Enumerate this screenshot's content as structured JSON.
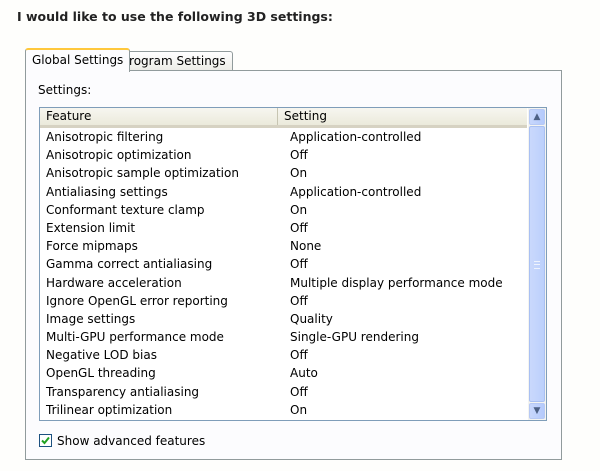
{
  "heading": "I would like to use the following 3D settings:",
  "tabs": [
    {
      "label": "Global Settings",
      "active": true
    },
    {
      "label": "Program Settings",
      "active": false
    }
  ],
  "settings_label": "Settings:",
  "columns": {
    "feature": "Feature",
    "setting": "Setting"
  },
  "rows": [
    {
      "feature": "Anisotropic filtering",
      "setting": "Application-controlled"
    },
    {
      "feature": "Anisotropic optimization",
      "setting": "Off"
    },
    {
      "feature": "Anisotropic sample optimization",
      "setting": "On"
    },
    {
      "feature": "Antialiasing settings",
      "setting": "Application-controlled"
    },
    {
      "feature": "Conformant texture clamp",
      "setting": "On"
    },
    {
      "feature": "Extension limit",
      "setting": "Off"
    },
    {
      "feature": "Force mipmaps",
      "setting": "None"
    },
    {
      "feature": "Gamma correct antialiasing",
      "setting": "Off"
    },
    {
      "feature": "Hardware acceleration",
      "setting": "Multiple display performance mode"
    },
    {
      "feature": "Ignore OpenGL error reporting",
      "setting": "Off"
    },
    {
      "feature": "Image settings",
      "setting": "Quality"
    },
    {
      "feature": "Multi-GPU performance mode",
      "setting": "Single-GPU rendering"
    },
    {
      "feature": "Negative LOD bias",
      "setting": "Off"
    },
    {
      "feature": "OpenGL threading",
      "setting": "Auto"
    },
    {
      "feature": "Transparency antialiasing",
      "setting": "Off"
    },
    {
      "feature": "Trilinear optimization",
      "setting": "On"
    }
  ],
  "scrollbar": {
    "up_icon": "arrow-up-icon",
    "down_icon": "arrow-down-icon"
  },
  "advanced": {
    "label": "Show advanced features",
    "checked": true,
    "icon": "check-icon"
  },
  "colors": {
    "tab_highlight": "#ffc83c",
    "scrollbar": "#c1d3fb",
    "checkmark": "#21a121"
  }
}
